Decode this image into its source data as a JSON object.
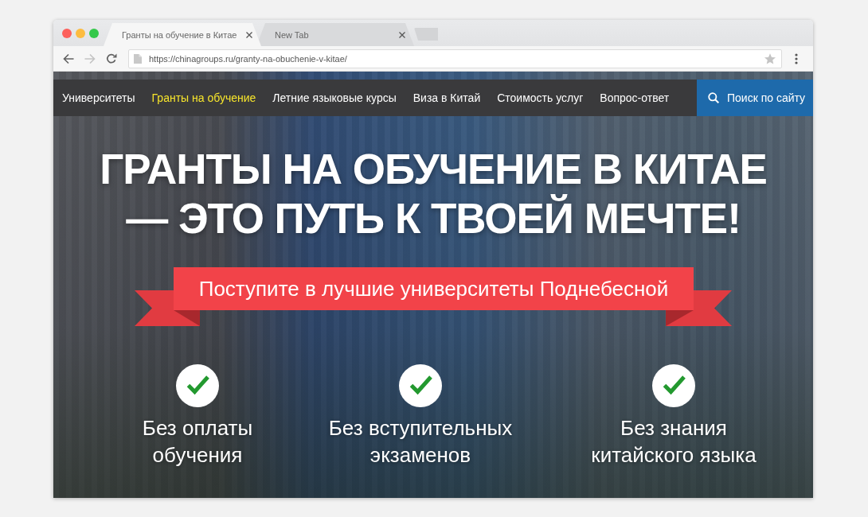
{
  "tabs": [
    {
      "title": "Гранты на обучение в Китае",
      "selected": true
    },
    {
      "title": "New Tab",
      "selected": false
    }
  ],
  "toolbar": {
    "back": {
      "disabled": false
    },
    "forward": {
      "disabled": true
    },
    "url": "https://chinagroups.ru/granty-na-obuchenie-v-kitae/"
  },
  "site": {
    "nav": [
      {
        "label": "Университеты",
        "selected": false
      },
      {
        "label": "Гранты на обучение",
        "selected": true
      },
      {
        "label": "Летние языковые курсы",
        "selected": false
      },
      {
        "label": "Виза в Китай",
        "selected": false
      },
      {
        "label": "Стоимость услуг",
        "selected": false
      },
      {
        "label": "Вопрос-ответ",
        "selected": false
      }
    ],
    "search_button": "Поиск по сайту",
    "headline_lines": [
      "ГРАНТЫ НА ОБУЧЕНИЕ В КИТАЕ",
      "— ЭТО ПУТЬ К ТВОЕЙ МЕЧТЕ!"
    ],
    "ribbon": "Поступите в лучшие университеты Поднебесной",
    "features": [
      {
        "lines": [
          "Без оплаты",
          "обучения"
        ]
      },
      {
        "lines": [
          "Без вступительных",
          "экзаменов"
        ]
      },
      {
        "lines": [
          "Без знания",
          "китайского языка"
        ]
      }
    ]
  }
}
